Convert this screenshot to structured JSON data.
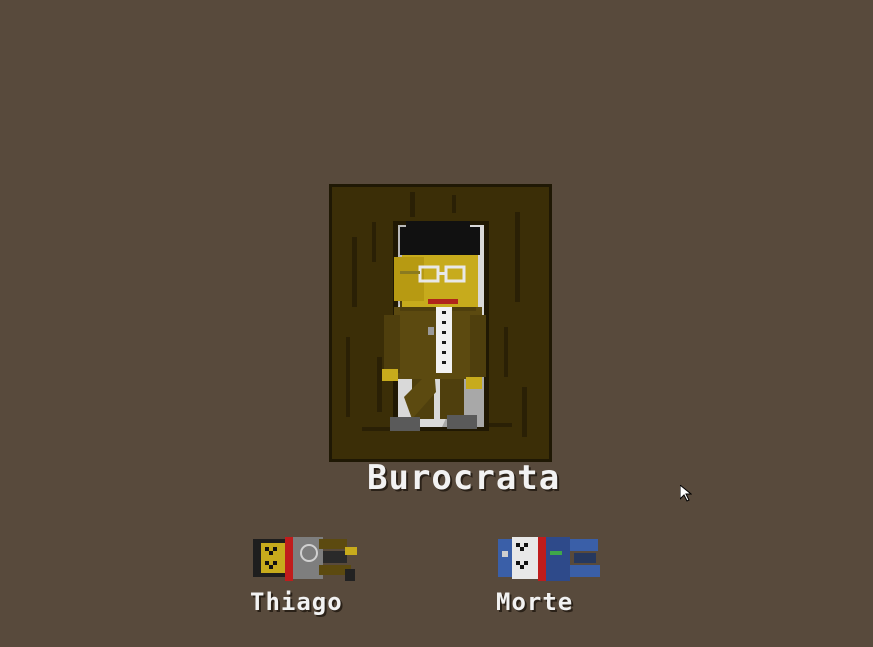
{
  "selected_character": {
    "name": "Burocrata"
  },
  "dead_characters": [
    {
      "name": "Thiago"
    },
    {
      "name": "Morte"
    }
  ],
  "colors": {
    "background": "#584a3c",
    "frame": "#3b2e07",
    "skin": "#c7ab1c",
    "suit": "#5c4a10",
    "label_text": "#f2f2f2"
  },
  "icons": {
    "cursor": "arrow-cursor-icon"
  }
}
